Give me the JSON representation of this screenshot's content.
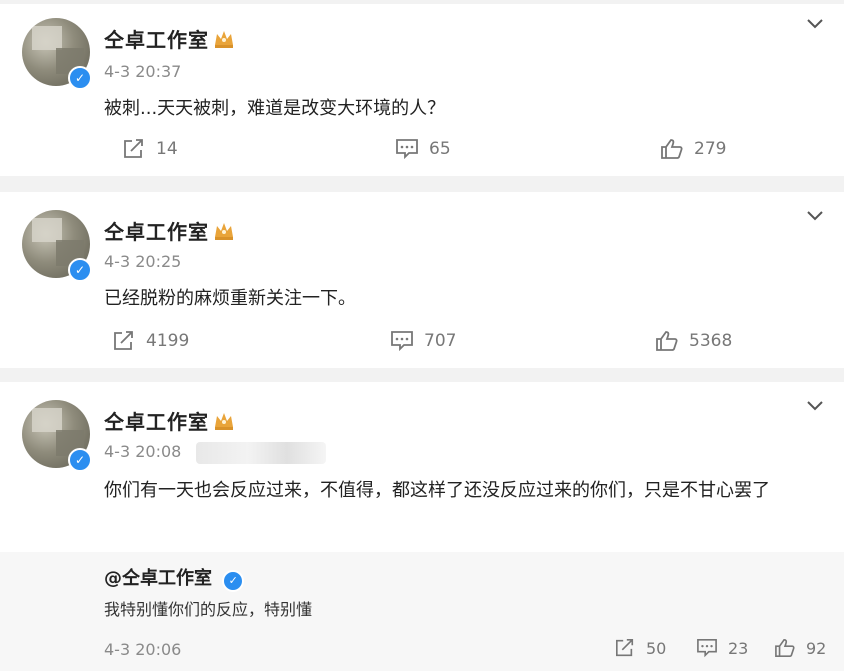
{
  "posts": [
    {
      "name": "仝卓工作室",
      "time": "4-3 20:37",
      "content": "被刺...天天被刺，难道是改变大环境的人？",
      "repost_count": "14",
      "comment_count": "65",
      "like_count": "279"
    },
    {
      "name": "仝卓工作室",
      "time": "4-3 20:25",
      "content": "已经脱粉的麻烦重新关注一下。",
      "repost_count": "4199",
      "comment_count": "707",
      "like_count": "5368"
    },
    {
      "name": "仝卓工作室",
      "time": "4-3 20:08",
      "content": "你们有一天也会反应过来，不值得，都这样了还没反应过来的你们，只是不甘心罢了"
    }
  ],
  "reply": {
    "name": "@仝卓工作室",
    "text": "我特别懂你们的反应，特别懂",
    "time": "4-3 20:06",
    "repost_count": "50",
    "comment_count": "23",
    "like_count": "92"
  },
  "icons": {
    "verified": "verified-check-icon",
    "crown": "crown-badge-icon",
    "menu": "chevron-down-icon",
    "repost": "share-icon",
    "comment": "comment-icon",
    "like": "thumbs-up-icon"
  },
  "colors": {
    "verified_blue": "#2b8ef0",
    "crown_gold": "#e9a43a",
    "muted_text": "#8a8a8a",
    "separator": "#f2f2f2"
  }
}
